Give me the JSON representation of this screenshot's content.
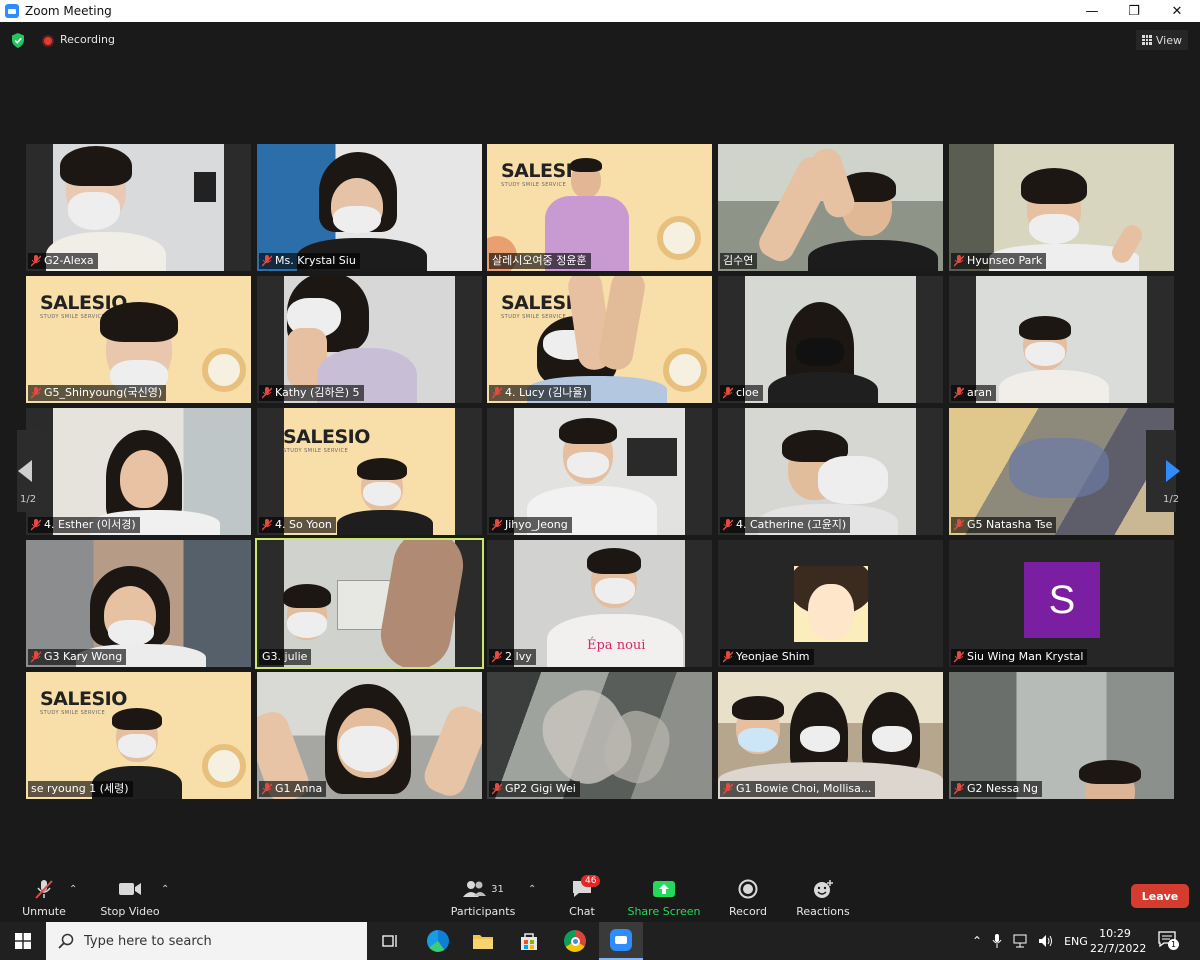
{
  "window": {
    "title": "Zoom Meeting",
    "minimize": "—",
    "restore": "❐",
    "close": "✕"
  },
  "topbar": {
    "recording_label": "Recording",
    "view_label": "View"
  },
  "participants": [
    {
      "name": "G2-Alexa",
      "muted": true
    },
    {
      "name": "Ms. Krystal Siu",
      "muted": true
    },
    {
      "name": "살레시오여중 정윤훈",
      "muted": false
    },
    {
      "name": "김수연",
      "muted": false
    },
    {
      "name": "Hyunseo Park",
      "muted": true
    },
    {
      "name": "G5_Shinyoung(국신영)",
      "muted": true
    },
    {
      "name": "Kathy (김하은) 5",
      "muted": true
    },
    {
      "name": "4. Lucy (김나율)",
      "muted": true
    },
    {
      "name": "cloe",
      "muted": true
    },
    {
      "name": "aran",
      "muted": true
    },
    {
      "name": "4. Esther (이서경)",
      "muted": true
    },
    {
      "name": "4. So Yoon",
      "muted": true
    },
    {
      "name": "Jihyo_Jeong",
      "muted": true
    },
    {
      "name": "4. Catherine (고윤지)",
      "muted": true
    },
    {
      "name": "G5 Natasha Tse",
      "muted": true
    },
    {
      "name": "G3 Kary Wong",
      "muted": true
    },
    {
      "name": "G3. julie",
      "muted": false
    },
    {
      "name": "2 Ivy",
      "muted": true
    },
    {
      "name": "Yeonjae Shim",
      "muted": true
    },
    {
      "name": "Siu Wing Man Krystal",
      "muted": true
    },
    {
      "name": "se ryoung 1 (세령)",
      "muted": false
    },
    {
      "name": "G1 Anna",
      "muted": true
    },
    {
      "name": "GP2 Gigi Wei",
      "muted": true
    },
    {
      "name": "G1 Bowie Choi, Mollisa...",
      "muted": true
    },
    {
      "name": "G2 Nessa Ng",
      "muted": true
    }
  ],
  "tile_text": {
    "logo": "SALESIO",
    "logo_sub": "STUDY SMILE SERVICE",
    "avatar_letter": "S",
    "shirt_text": "Épa noui"
  },
  "nav": {
    "page_left": "1/2",
    "page_right": "1/2"
  },
  "toolbar": {
    "unmute": "Unmute",
    "stop_video": "Stop Video",
    "participants": "Participants",
    "participants_count": "31",
    "chat": "Chat",
    "chat_badge": "46",
    "share_screen": "Share Screen",
    "record": "Record",
    "reactions": "Reactions",
    "leave": "Leave"
  },
  "taskbar": {
    "search_placeholder": "Type here to search",
    "lang": "ENG",
    "time": "10:29",
    "date": "22/7/2022",
    "notifications": "1"
  },
  "colors": {
    "accent": "#2d8cff",
    "leave": "#d63b30",
    "share": "#23d959",
    "active_speaker": "#cbe86b",
    "avatar": "#7b1fa2"
  }
}
